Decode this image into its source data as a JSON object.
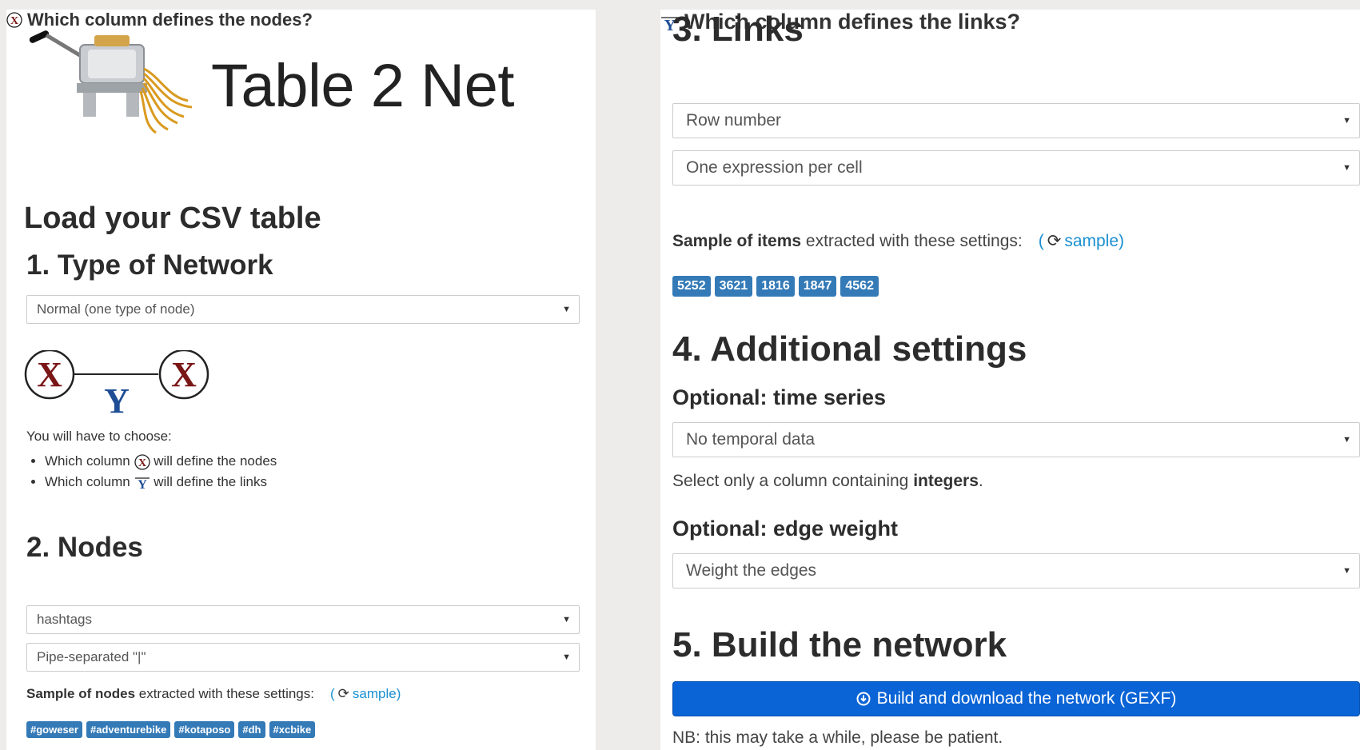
{
  "app": {
    "title": "Table 2 Net"
  },
  "load": {
    "heading": "Load your CSV table"
  },
  "network_type": {
    "heading": "1. Type of Network",
    "selected": "Normal (one type of node)",
    "choose_intro": "You will have to choose:",
    "choose_items": [
      {
        "prefix": "Which column",
        "suffix": "will define the nodes"
      },
      {
        "prefix": "Which column",
        "suffix": "will define the links"
      }
    ]
  },
  "nodes": {
    "heading": "2. Nodes",
    "question": "Which column defines the nodes?",
    "column": "hashtags",
    "separator": "Pipe-separated \"|\"",
    "sample_bold": "Sample of nodes",
    "sample_rest": " extracted with these settings:",
    "sample_link": "sample)",
    "sample_paren": "(",
    "tags": [
      "#goweser",
      "#adventurebike",
      "#kotaposo",
      "#dh",
      "#xcbike"
    ]
  },
  "links": {
    "heading": "3. Links",
    "question": "Which column defines the links?",
    "column": "Row number",
    "mode": "One expression per cell",
    "sample_bold": "Sample of items",
    "sample_rest": " extracted with these settings:",
    "sample_link": "sample)",
    "sample_paren": "(",
    "tags": [
      "5252",
      "3621",
      "1816",
      "1847",
      "4562"
    ]
  },
  "additional": {
    "heading": "4. Additional settings",
    "time_heading": "Optional: time series",
    "time_selected": "No temporal data",
    "time_hint_pre": "Select only a column containing ",
    "time_hint_bold": "integers",
    "time_hint_post": ".",
    "weight_heading": "Optional: edge weight",
    "weight_selected": "Weight the edges"
  },
  "build": {
    "heading": "5. Build the network",
    "button": "Build and download the network (GEXF)",
    "note": "NB: this may take a while, please be patient."
  },
  "diagram": {
    "node_letter": "X",
    "link_letter": "Y"
  },
  "colors": {
    "accent": "#337ab7",
    "link": "#1a8fd0",
    "button": "#0a64d6",
    "node_letter": "#7a1616",
    "link_letter": "#1f4e96"
  }
}
